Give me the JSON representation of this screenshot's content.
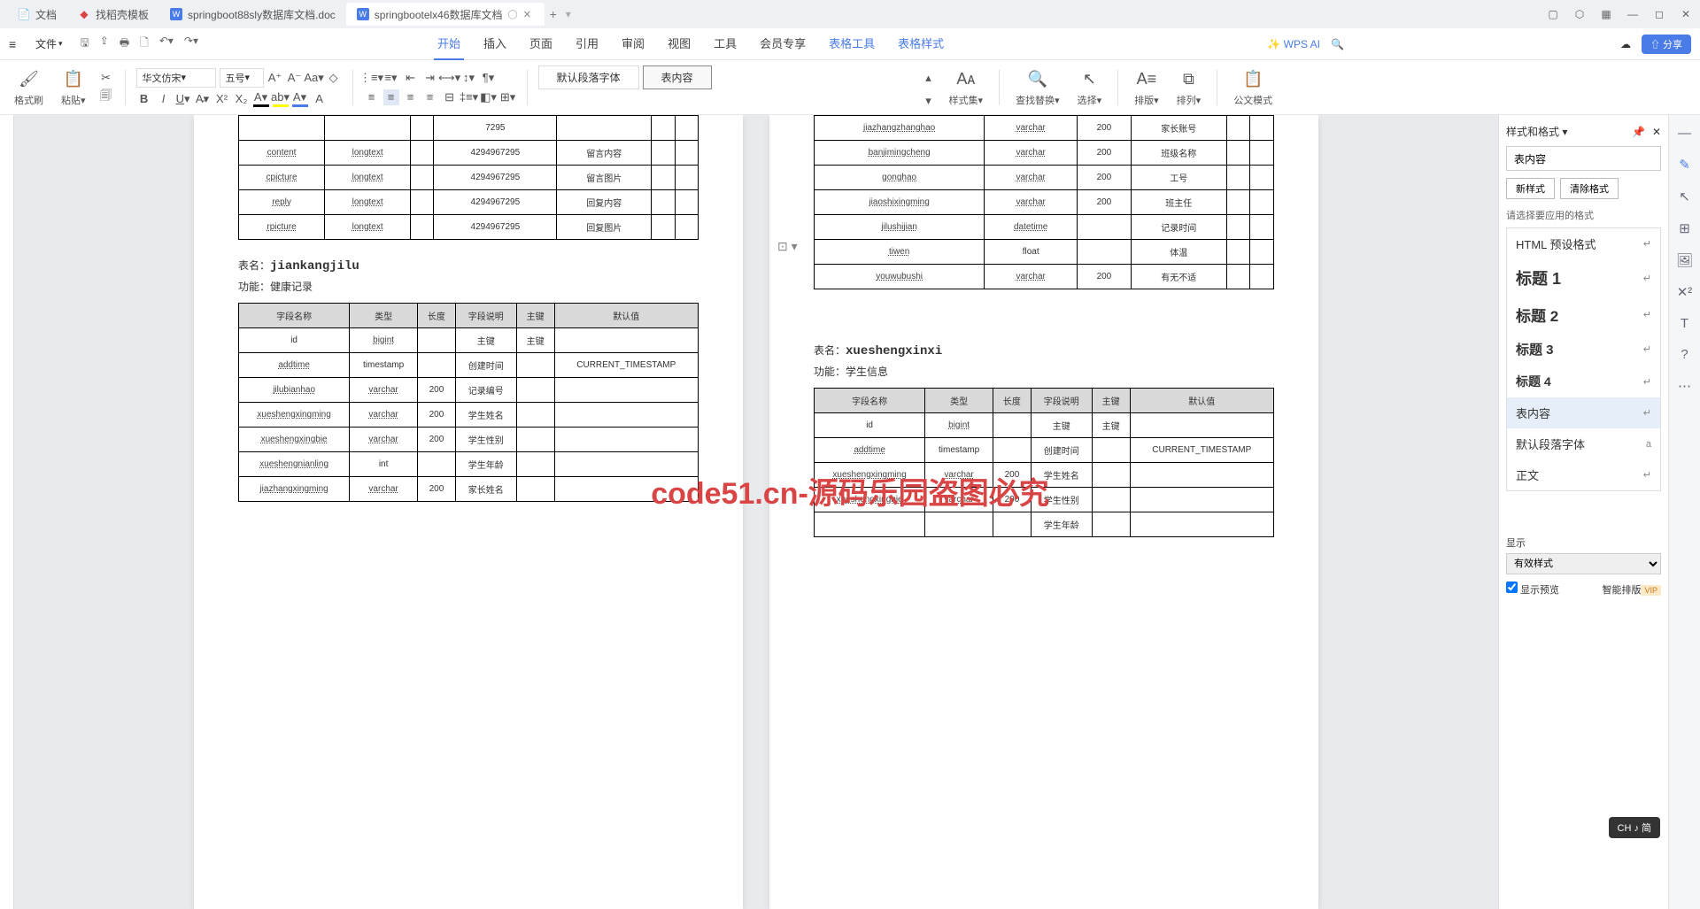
{
  "titlebar": {
    "tabs": [
      {
        "label": "文档",
        "icon": "📄"
      },
      {
        "label": "找稻壳模板",
        "icon": "🔍"
      },
      {
        "label": "springboot88sly数据库文档.doc",
        "icon": "W"
      },
      {
        "label": "springbootelx46数据库文档",
        "icon": "W",
        "active": true
      }
    ],
    "newtab": "+"
  },
  "menubar": {
    "file": "文件",
    "tabs": [
      "开始",
      "插入",
      "页面",
      "引用",
      "审阅",
      "视图",
      "工具",
      "会员专享",
      "表格工具",
      "表格样式"
    ],
    "active": 0,
    "ai": "WPS AI",
    "share": "分享"
  },
  "toolbar": {
    "brush": "格式刷",
    "paste": "粘贴",
    "font": "华文仿宋",
    "size": "五号",
    "style_default": "默认段落字体",
    "style_content": "表内容",
    "styleset": "样式集",
    "find": "查找替换",
    "select": "选择",
    "section": "排版",
    "arrange": "排列",
    "docmode": "公文模式"
  },
  "page_left": {
    "top_rows": [
      [
        "",
        "",
        "",
        "7295",
        "",
        "",
        ""
      ],
      [
        "content",
        "longtext",
        "",
        "4294967295",
        "留言内容",
        "",
        ""
      ],
      [
        "cpicture",
        "longtext",
        "",
        "4294967295",
        "留言图片",
        "",
        ""
      ],
      [
        "reply",
        "longtext",
        "",
        "4294967295",
        "回复内容",
        "",
        ""
      ],
      [
        "rpicture",
        "longtext",
        "",
        "4294967295",
        "回复图片",
        "",
        ""
      ]
    ],
    "table2_name": "表名：",
    "table2_val": "jiankangjilu",
    "func2": "功能：健康记录",
    "headers": [
      "字段名称",
      "类型",
      "长度",
      "字段说明",
      "主键",
      "默认值"
    ],
    "rows2": [
      [
        "id",
        "bigint",
        "",
        "主键",
        "主键",
        ""
      ],
      [
        "addtime",
        "timestamp",
        "",
        "创建时间",
        "",
        "CURRENT_TIMESTAMP"
      ],
      [
        "jilubianhao",
        "varchar",
        "200",
        "记录编号",
        "",
        ""
      ],
      [
        "xueshengxingming",
        "varchar",
        "200",
        "学生姓名",
        "",
        ""
      ],
      [
        "xueshengxingbie",
        "varchar",
        "200",
        "学生性别",
        "",
        ""
      ],
      [
        "xueshengnianling",
        "int",
        "",
        "学生年龄",
        "",
        ""
      ],
      [
        "jiazhangxingming",
        "varchar",
        "200",
        "家长姓名",
        "",
        ""
      ]
    ]
  },
  "page_right": {
    "top_rows": [
      [
        "jiazhangzhanghao",
        "varchar",
        "200",
        "家长账号",
        "",
        ""
      ],
      [
        "banjimingcheng",
        "varchar",
        "200",
        "班级名称",
        "",
        ""
      ],
      [
        "gonghao",
        "varchar",
        "200",
        "工号",
        "",
        ""
      ],
      [
        "jiaoshixingming",
        "varchar",
        "200",
        "班主任",
        "",
        ""
      ],
      [
        "jilushijian",
        "datetime",
        "",
        "记录时间",
        "",
        ""
      ],
      [
        "tiwen",
        "float",
        "",
        "体温",
        "",
        ""
      ],
      [
        "youwubushi",
        "varchar",
        "200",
        "有无不适",
        "",
        ""
      ]
    ],
    "table2_name": "表名：",
    "table2_val": "xueshengxinxi",
    "func2": "功能：学生信息",
    "headers": [
      "字段名称",
      "类型",
      "长度",
      "字段说明",
      "主键",
      "默认值"
    ],
    "rows2": [
      [
        "id",
        "bigint",
        "",
        "主键",
        "主键",
        ""
      ],
      [
        "addtime",
        "timestamp",
        "",
        "创建时间",
        "",
        "CURRENT_TIMESTAMP"
      ],
      [
        "xueshengxingming",
        "varchar",
        "200",
        "学生姓名",
        "",
        ""
      ],
      [
        "xueshengxingbie",
        "varchar",
        "200",
        "学生性别",
        "",
        ""
      ],
      [
        "",
        "",
        "",
        "学生年龄",
        "",
        ""
      ]
    ]
  },
  "watermark": "code51.cn-源码乐园盗图必究",
  "sidepanel": {
    "title": "样式和格式",
    "current": "表内容",
    "newstyle": "新样式",
    "clear": "清除格式",
    "hint": "请选择要应用的格式",
    "items": [
      {
        "label": "HTML 预设格式",
        "cls": ""
      },
      {
        "label": "标题 1",
        "cls": "h1"
      },
      {
        "label": "标题 2",
        "cls": "h2"
      },
      {
        "label": "标题 3",
        "cls": "h3"
      },
      {
        "label": "标题 4",
        "cls": "h4"
      },
      {
        "label": "表内容",
        "cls": "",
        "sel": true
      },
      {
        "label": "默认段落字体",
        "cls": ""
      },
      {
        "label": "正文",
        "cls": ""
      }
    ],
    "show_label": "显示",
    "show_value": "有效样式",
    "preview": "显示预览",
    "smart": "智能排版",
    "vip": "VIP"
  },
  "ime": "CH ♪ 简"
}
